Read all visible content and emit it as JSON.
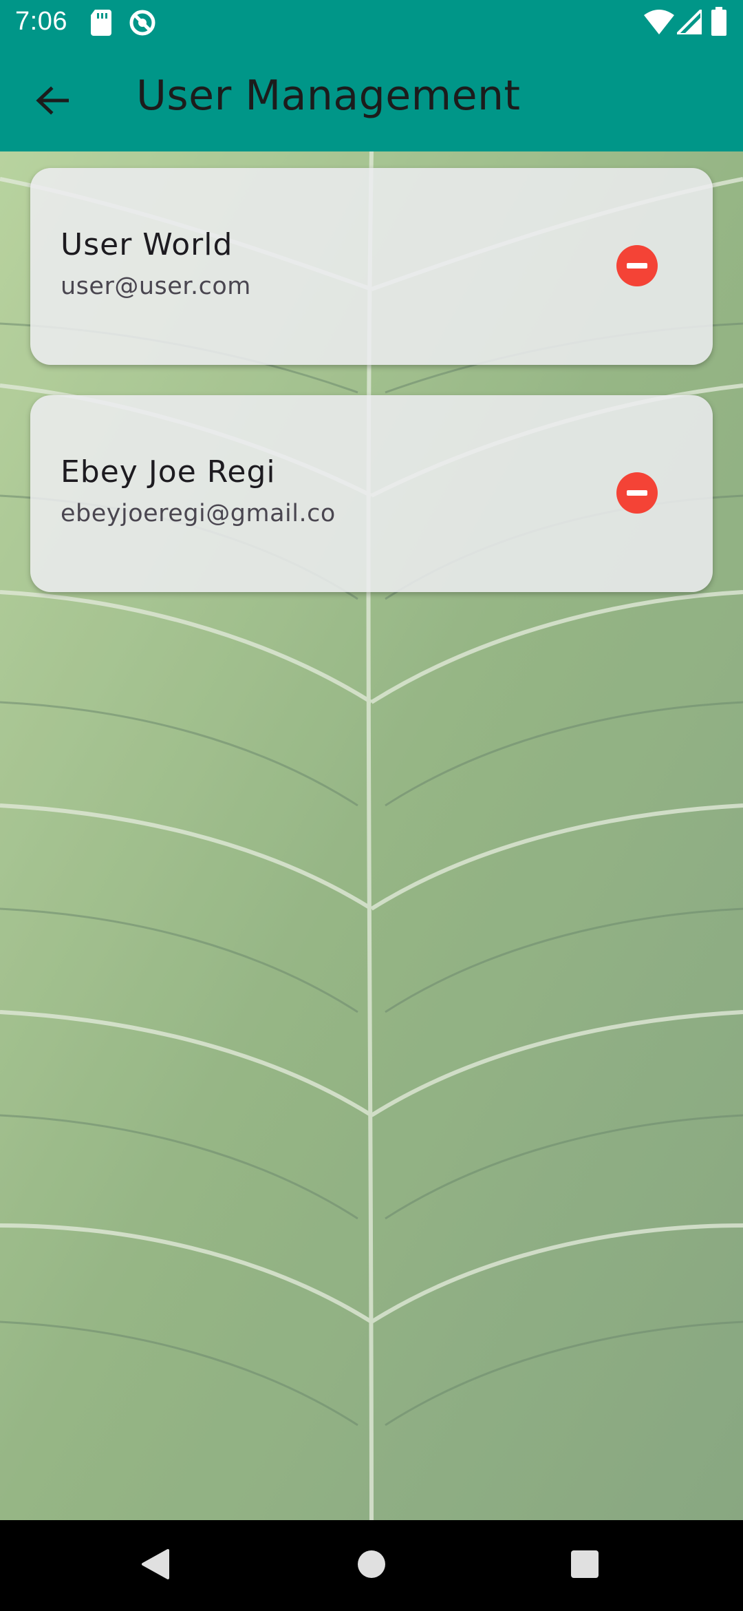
{
  "status_bar": {
    "time": "7:06",
    "icons": [
      "sd-card-icon",
      "sync-icon",
      "wifi-icon",
      "signal-icon",
      "battery-icon"
    ]
  },
  "app_bar": {
    "title": "User Management",
    "back_icon": "arrow-back-icon",
    "background_color": "#009688"
  },
  "users": [
    {
      "name": "User World",
      "email": "user@user.com",
      "action_icon": "remove-circle-icon"
    },
    {
      "name": "Ebey Joe Regi",
      "email": "ebeyjoeregi@gmail.co",
      "action_icon": "remove-circle-icon"
    }
  ],
  "nav_bar": {
    "buttons": [
      "back-triangle-icon",
      "home-circle-icon",
      "recents-square-icon"
    ]
  },
  "colors": {
    "accent": "#009688",
    "remove": "#f44336",
    "card": "#ececf0"
  }
}
